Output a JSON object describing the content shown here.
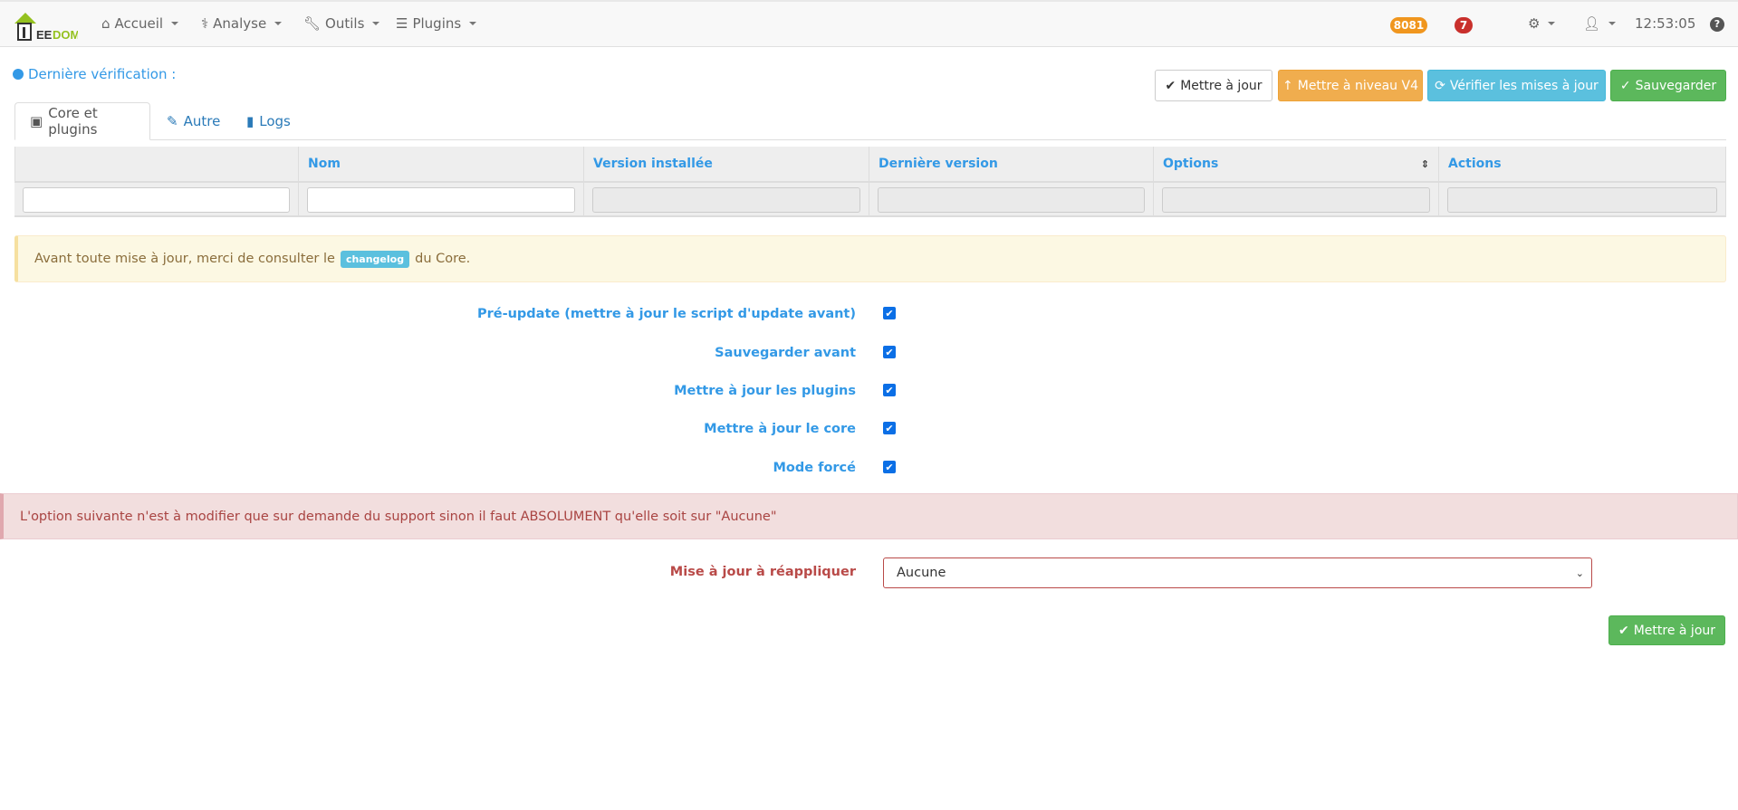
{
  "navbar": {
    "logo": "JEEDOM",
    "items": [
      {
        "label": "Accueil"
      },
      {
        "label": "Analyse"
      },
      {
        "label": "Outils"
      },
      {
        "label": "Plugins"
      }
    ],
    "badge_orange": "8081",
    "badge_red": "7",
    "time": "12:53:05",
    "colors": {
      "orange": "#f0961e",
      "red": "#c9302c"
    }
  },
  "header": {
    "last_check": "Dernière vérification :"
  },
  "buttons": {
    "update": "Mettre à jour",
    "upgrade": "Mettre à niveau V4",
    "check": "Vérifier les mises à jour",
    "save": "Sauvegarder"
  },
  "tabs": [
    {
      "label": "Core et plugins"
    },
    {
      "label": "Autre"
    },
    {
      "label": "Logs"
    }
  ],
  "table": {
    "columns": [
      "",
      "Nom",
      "Version installée",
      "Dernière version",
      "Options",
      "Actions"
    ]
  },
  "warning": {
    "before": "Avant toute mise à jour, merci de consulter le",
    "tag": "changelog",
    "after": "du Core."
  },
  "options": [
    {
      "label": "Pré-update (mettre à jour le script d'update avant)",
      "checked": true
    },
    {
      "label": "Sauvegarder avant",
      "checked": true
    },
    {
      "label": "Mettre à jour les plugins",
      "checked": true
    },
    {
      "label": "Mettre à jour le core",
      "checked": true
    },
    {
      "label": "Mode forcé",
      "checked": true
    }
  ],
  "danger": {
    "text": "L'option suivante n'est à modifier que sur demande du support sinon il faut ABSOLUMENT qu'elle soit sur \"Aucune\""
  },
  "reapply": {
    "label": "Mise à jour à réappliquer",
    "value": "Aucune"
  },
  "footer": {
    "update": "Mettre à jour"
  }
}
